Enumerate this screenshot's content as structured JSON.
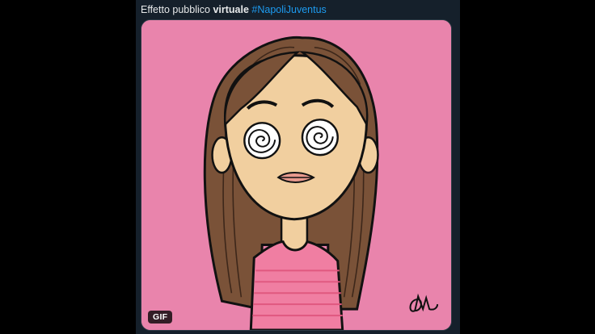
{
  "tweet": {
    "text_part1": "Effetto pubblico",
    "text_bold": "virtuale",
    "hashtag": "#NapoliJuventus"
  },
  "media": {
    "badge": "GIF",
    "background_color": "#e984ac",
    "signature": "DM"
  },
  "colors": {
    "panel": "#15202b",
    "hashtag": "#1d9bf0",
    "hair": "#7a5238",
    "skin": "#f1cf9f",
    "shirt": "#f07ea2"
  }
}
